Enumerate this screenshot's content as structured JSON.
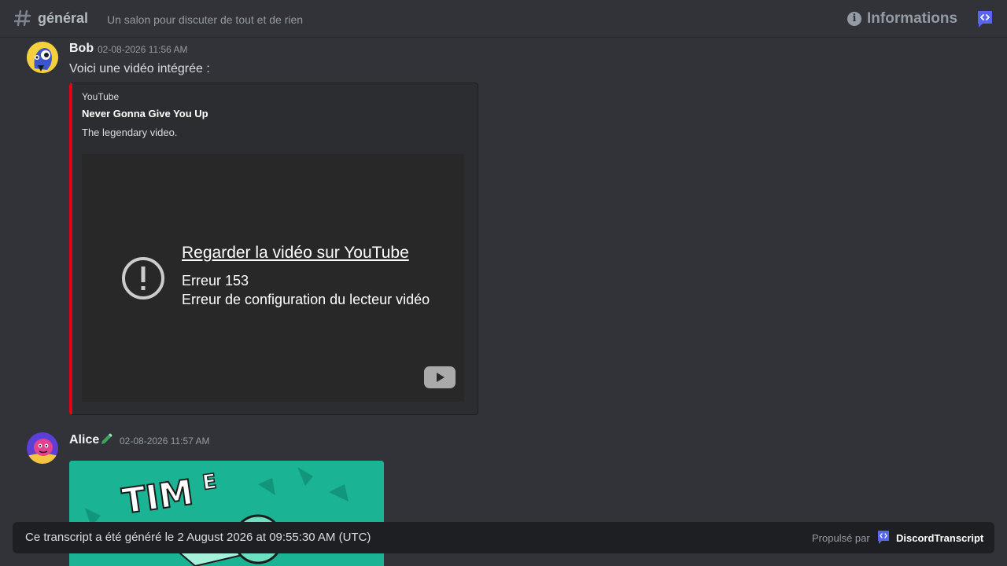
{
  "header": {
    "channel_name": "général",
    "topic": "Un salon pour discuter de tout et de rien",
    "info_label": "Informations",
    "icons": [
      "hash-icon",
      "info-icon",
      "discord-transcript-logo-icon"
    ]
  },
  "messages": [
    {
      "author": "Bob",
      "timestamp": "02-08-2026 11:56 AM",
      "text": "Voici une vidéo intégrée :",
      "embed": {
        "provider": "YouTube",
        "title": "Never Gonna Give You Up",
        "description": "The legendary video.",
        "accent_color": "#e60012",
        "player": {
          "link_text": "Regarder la vidéo sur YouTube",
          "error_code": "Erreur 153",
          "error_message": "Erreur de configuration du lecteur vidéo"
        }
      }
    },
    {
      "author": "Alice",
      "timestamp": "02-08-2026 11:57 AM",
      "badge_icon": "pencil-icon",
      "image_color": "#1ab394"
    }
  ],
  "footer": {
    "text": "Ce transcript a été généré le 2 August 2026 at 09:55:30 AM (UTC)",
    "powered_label": "Propulsé par",
    "powered_brand": "DiscordTranscript"
  },
  "colors": {
    "background": "#313338",
    "brand": "#5865f2"
  }
}
